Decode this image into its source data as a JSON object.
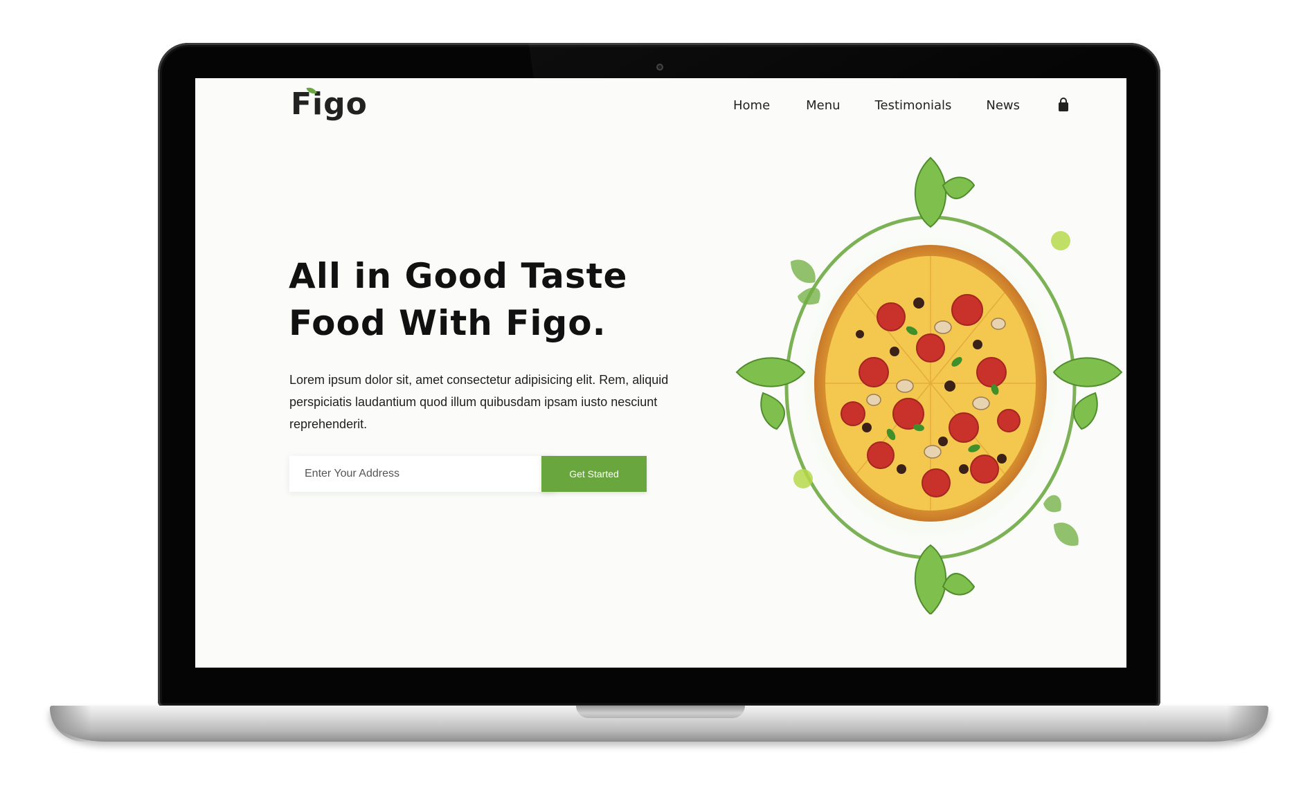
{
  "nav": {
    "brand": "Figo",
    "links": [
      "Home",
      "Menu",
      "Testimonials",
      "News"
    ],
    "cart_icon": "shopping-bag-icon"
  },
  "hero": {
    "title_line1": "All in Good Taste",
    "title_line2": "Food With Figo.",
    "description": "Lorem ipsum dolor sit, amet consectetur adipisicing elit. Rem, aliquid perspiciatis laudantium quod illum quibusdam ipsam iusto nesciunt reprehenderit.",
    "address_placeholder": "Enter Your Address",
    "cta_label": "Get Started",
    "image": "pizza-with-basil-leaves-image"
  },
  "colors": {
    "accent": "#6aa63e",
    "screen_bg": "#fbfcfa",
    "text": "#111111"
  }
}
